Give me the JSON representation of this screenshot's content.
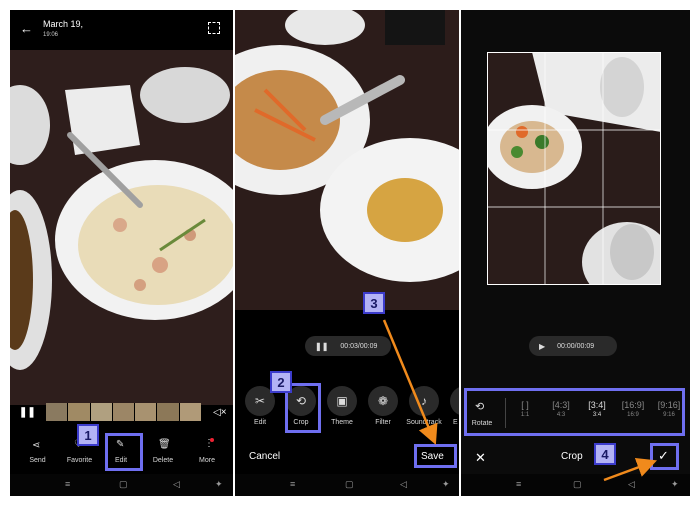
{
  "colors": {
    "callout_fill": "#b3b3f5",
    "callout_border": "#3c3ccc",
    "highlight": "#6f6ff0",
    "arrow": "#f08a1c"
  },
  "panel1": {
    "date": "March 19,",
    "time": "19:06",
    "actions": [
      {
        "icon": "share-icon",
        "label": "Send"
      },
      {
        "icon": "heart-icon",
        "label": "Favorite"
      },
      {
        "icon": "pencil-icon",
        "label": "Edit"
      },
      {
        "icon": "trash-icon",
        "label": "Delete"
      },
      {
        "icon": "more-icon",
        "label": "More"
      }
    ]
  },
  "panel2": {
    "timecode": "00:03/00:09",
    "tools": [
      {
        "icon": "scissors-icon",
        "label": "Edit"
      },
      {
        "icon": "crop-icon",
        "label": "Crop"
      },
      {
        "icon": "theme-icon",
        "label": "Theme"
      },
      {
        "icon": "filter-icon",
        "label": "Filter"
      },
      {
        "icon": "music-icon",
        "label": "Soundtrack"
      },
      {
        "icon": "effect-icon",
        "label": "E"
      }
    ],
    "cancel_label": "Cancel",
    "save_label": "Save"
  },
  "panel3": {
    "timecode": "00:00/00:09",
    "rotate_label": "Rotate",
    "ratios": [
      {
        "glyph": "[ ]",
        "label": "1:1"
      },
      {
        "glyph": "[4:3]",
        "label": "4:3"
      },
      {
        "glyph": "[3:4]",
        "label": "3:4"
      },
      {
        "glyph": "[16:9]",
        "label": "16:9"
      },
      {
        "glyph": "[9:16]",
        "label": "9:16"
      }
    ],
    "crop_title": "Crop"
  },
  "callouts": [
    "1",
    "2",
    "3",
    "4"
  ]
}
